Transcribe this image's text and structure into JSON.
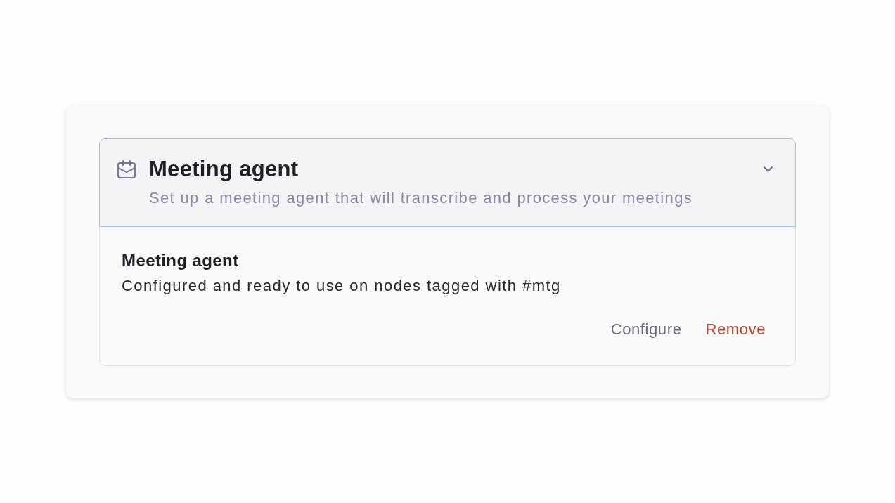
{
  "section": {
    "title": "Meeting agent",
    "subtitle": "Set up a meeting agent that will transcribe and process your meetings",
    "expanded": true,
    "agent": {
      "name": "Meeting agent",
      "status": "Configured and ready to use on nodes tagged with #mtg"
    },
    "actions": [
      {
        "label": "Configure",
        "kind": "neutral"
      },
      {
        "label": "Remove",
        "kind": "danger"
      }
    ]
  }
}
